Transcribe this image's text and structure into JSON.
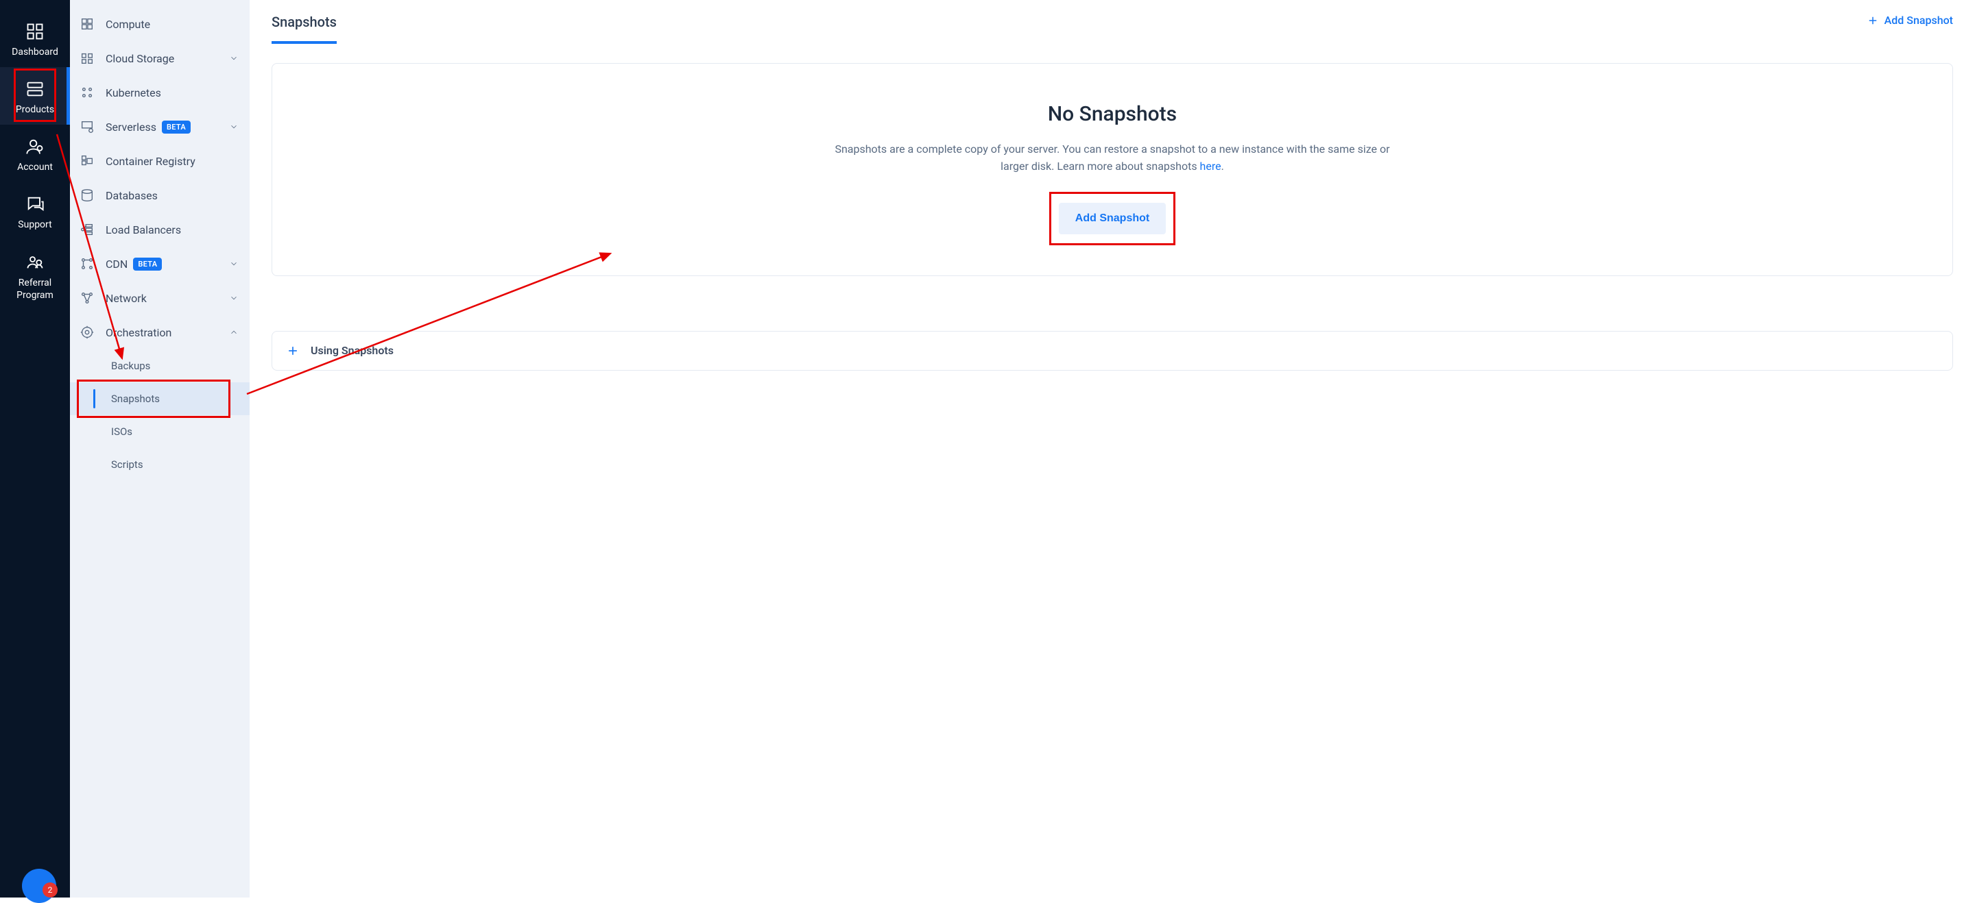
{
  "primary_nav": {
    "dashboard": "Dashboard",
    "products": "Products",
    "account": "Account",
    "support": "Support",
    "referral": "Referral Program",
    "notif_count": "2"
  },
  "secondary_nav": {
    "compute": "Compute",
    "cloud_storage": "Cloud Storage",
    "kubernetes": "Kubernetes",
    "serverless": "Serverless",
    "container_registry": "Container Registry",
    "databases": "Databases",
    "load_balancers": "Load Balancers",
    "cdn": "CDN",
    "network": "Network",
    "orchestration": "Orchestration",
    "beta_badge": "BETA",
    "sub_backups": "Backups",
    "sub_snapshots": "Snapshots",
    "sub_isos": "ISOs",
    "sub_scripts": "Scripts"
  },
  "main": {
    "tab_label": "Snapshots",
    "add_link": "Add Snapshot",
    "empty_title": "No Snapshots",
    "empty_desc_a": "Snapshots are a complete copy of your server. You can restore a snapshot to a new instance with the same size or larger disk. Learn more about snapshots ",
    "empty_desc_link": "here",
    "empty_desc_b": ".",
    "empty_cta": "Add Snapshot",
    "accordion": "Using Snapshots"
  }
}
